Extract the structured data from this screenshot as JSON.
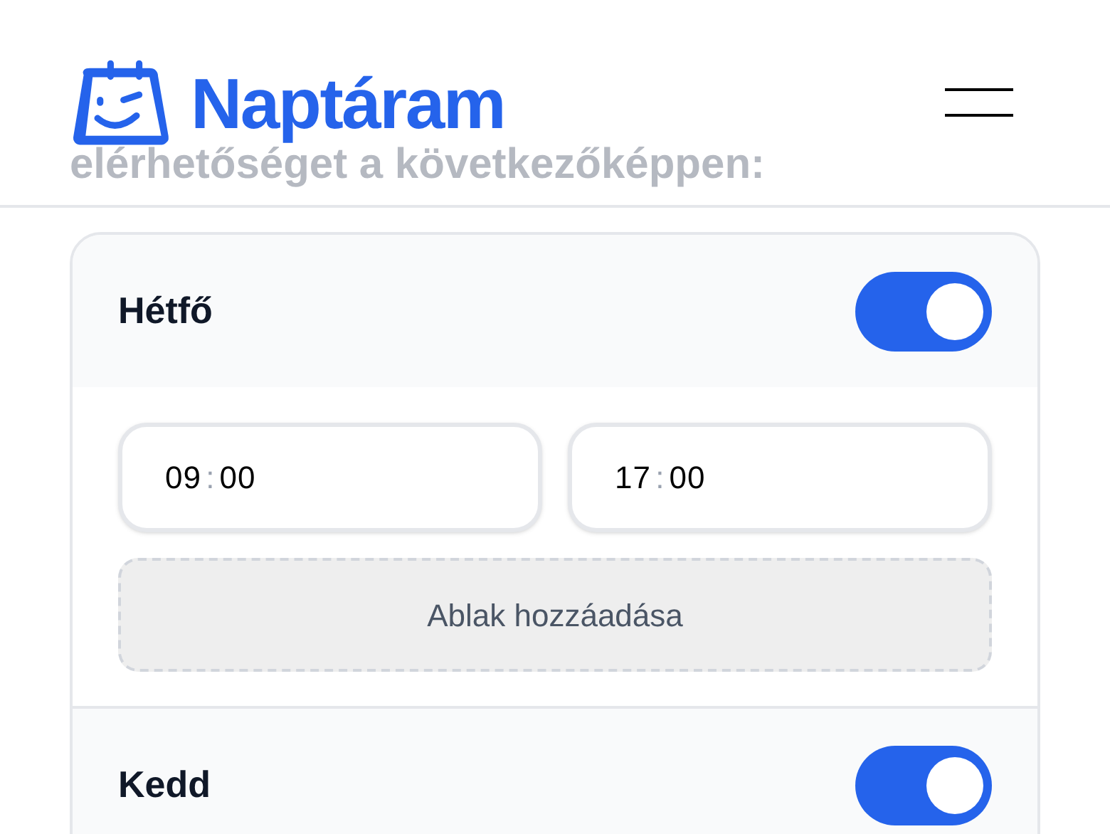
{
  "header": {
    "logo_text": "Naptáram"
  },
  "intro_text": "elérhetőséget a következőképpen:",
  "days": [
    {
      "name": "Hétfő",
      "on": true,
      "windows": [
        {
          "start": {
            "hours": "09",
            "separator": ":",
            "minutes": "00"
          },
          "end": {
            "hours": "17",
            "separator": ":",
            "minutes": "00"
          }
        }
      ],
      "add_button": "Ablak hozzáadása"
    },
    {
      "name": "Kedd",
      "on": true
    }
  ]
}
